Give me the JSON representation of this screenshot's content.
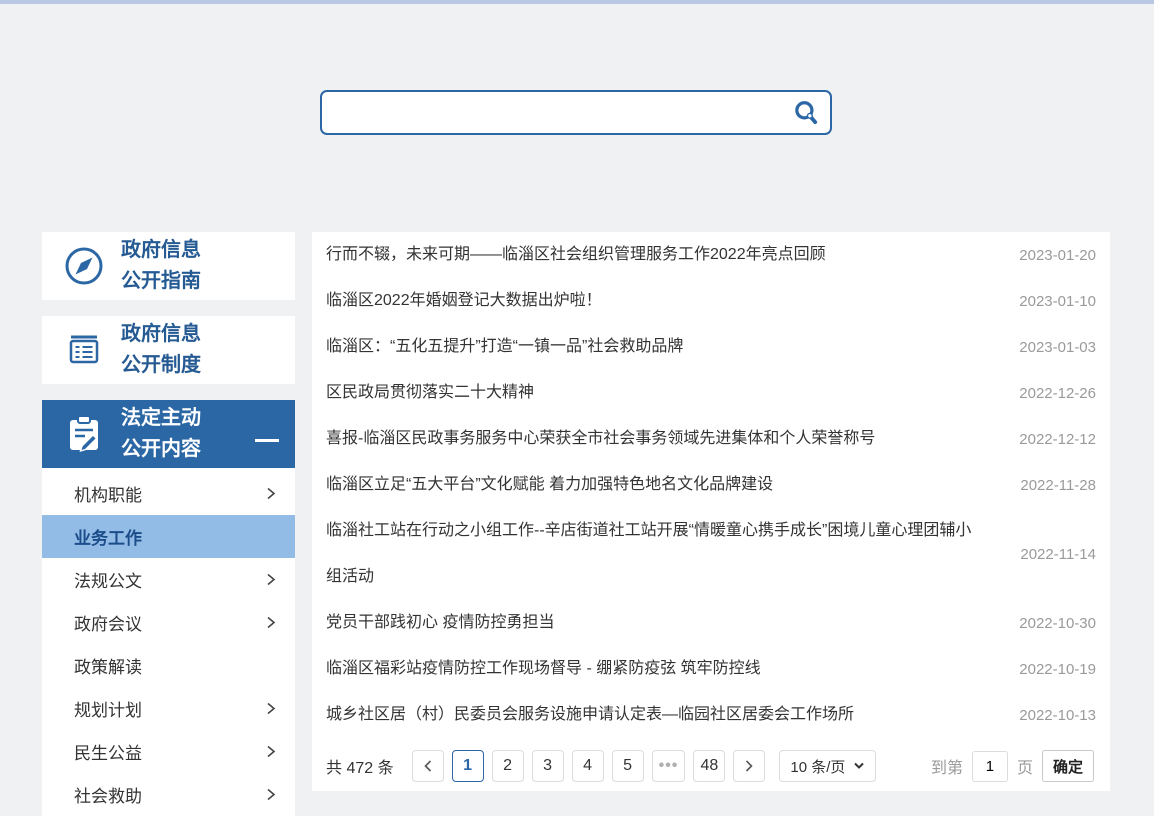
{
  "colors": {
    "brand": "#2c67a5",
    "highlight": "#92bbe5",
    "top_strip": "#b9c7e3",
    "page_bg": "#f0f1f2"
  },
  "search": {
    "value": ""
  },
  "sidebar": {
    "cards": [
      {
        "line1": "政府信息",
        "line2": "公开指南"
      },
      {
        "line1": "政府信息",
        "line2": "公开制度"
      },
      {
        "line1": "法定主动",
        "line2": "公开内容"
      }
    ],
    "menu": [
      {
        "label": "机构职能",
        "chevron": true
      },
      {
        "label": "业务工作",
        "active": true
      },
      {
        "label": "法规公文",
        "chevron": true
      },
      {
        "label": "政府会议",
        "chevron": true
      },
      {
        "label": "政策解读"
      },
      {
        "label": "规划计划",
        "chevron": true
      },
      {
        "label": "民生公益",
        "chevron": true
      },
      {
        "label": "社会救助",
        "chevron": true
      }
    ]
  },
  "articles": [
    {
      "title": "行而不辍，未来可期——临淄区社会组织管理服务工作2022年亮点回顾",
      "date": "2023-01-20"
    },
    {
      "title": "临淄区2022年婚姻登记大数据出炉啦！",
      "date": "2023-01-10"
    },
    {
      "title": "临淄区：“五化五提升”打造“一镇一品”社会救助品牌",
      "date": "2023-01-03"
    },
    {
      "title": "区民政局贯彻落实二十大精神",
      "date": "2022-12-26"
    },
    {
      "title": "喜报-临淄区民政事务服务中心荣获全市社会事务领域先进集体和个人荣誉称号",
      "date": "2022-12-12"
    },
    {
      "title": "临淄区立足“五大平台”文化赋能 着力加强特色地名文化品牌建设",
      "date": "2022-11-28"
    },
    {
      "title": "临淄社工站在行动之小组工作--辛店街道社工站开展“情暖童心携手成长”困境儿童心理团辅小组活动",
      "date": "2022-11-14"
    },
    {
      "title": "党员干部践初心 疫情防控勇担当",
      "date": "2022-10-30"
    },
    {
      "title": "临淄区福彩站疫情防控工作现场督导 - 绷紧防疫弦 筑牢防控线",
      "date": "2022-10-19"
    },
    {
      "title": "城乡社区居（村）民委员会服务设施申请认定表—临园社区居委会工作场所",
      "date": "2022-10-13"
    }
  ],
  "pagination": {
    "total_label": "共 472 条",
    "pages": [
      {
        "label": "1",
        "active": true
      },
      {
        "label": "2"
      },
      {
        "label": "3"
      },
      {
        "label": "4"
      },
      {
        "label": "5"
      },
      {
        "label": "•••",
        "ellipsis": true
      },
      {
        "label": "48"
      }
    ],
    "page_size": "10 条/页",
    "jump_prefix": "到第",
    "jump_value": "1",
    "jump_suffix": "页",
    "confirm_label": "确定"
  }
}
